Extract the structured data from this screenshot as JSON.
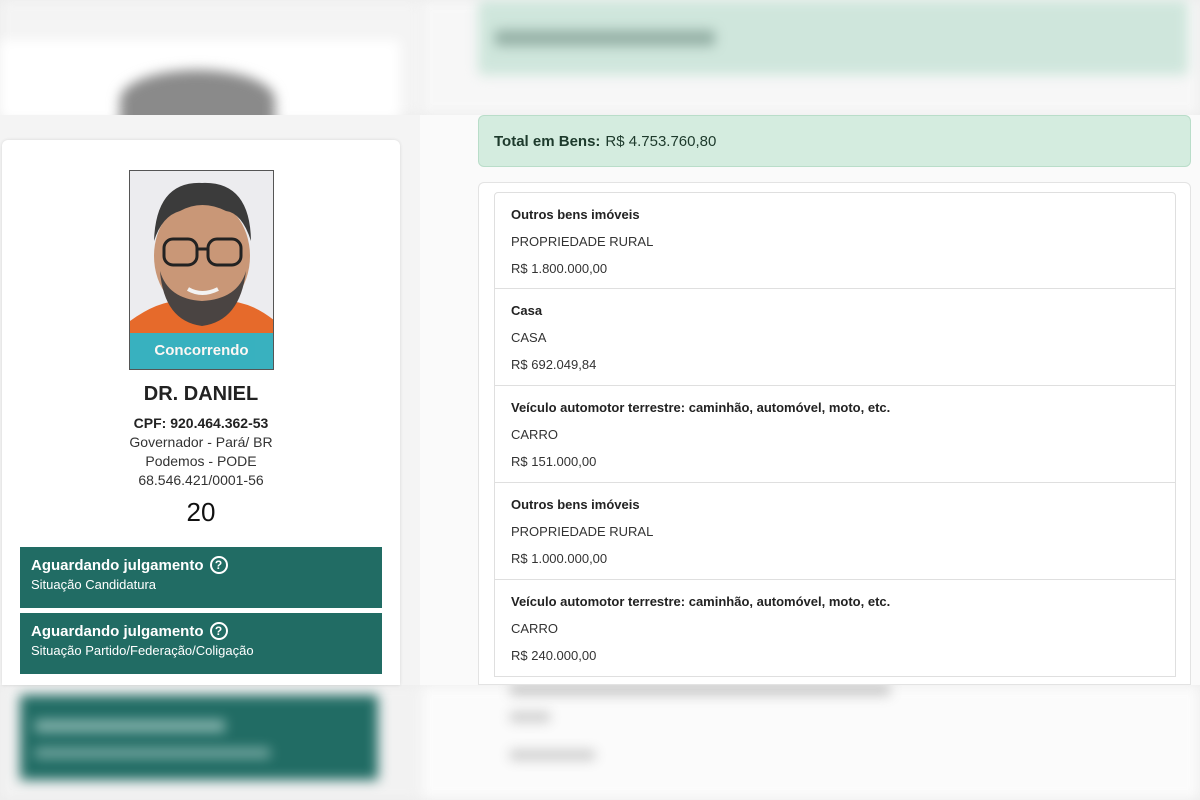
{
  "candidate": {
    "photo_badge": "Concorrendo",
    "name": "DR. DANIEL",
    "cpf": "CPF: 920.464.362-53",
    "office": "Governador - Pará/ BR",
    "party": "Podemos - PODE",
    "cnpj": "68.546.421/0001-56",
    "number": "20"
  },
  "status": [
    {
      "title": "Aguardando julgamento",
      "subtitle": "Situação Candidatura"
    },
    {
      "title": "Aguardando julgamento",
      "subtitle": "Situação Partido/Federação/Coligação"
    }
  ],
  "total": {
    "label": "Total em Bens:",
    "value": "R$ 4.753.760,80"
  },
  "assets": [
    {
      "type": "Outros bens imóveis",
      "description": "PROPRIEDADE RURAL",
      "value": "R$ 1.800.000,00"
    },
    {
      "type": "Casa",
      "description": "CASA",
      "value": "R$ 692.049,84"
    },
    {
      "type": "Veículo automotor terrestre: caminhão, automóvel, moto, etc.",
      "description": "CARRO",
      "value": "R$ 151.000,00"
    },
    {
      "type": "Outros bens imóveis",
      "description": "PROPRIEDADE RURAL",
      "value": "R$ 1.000.000,00"
    },
    {
      "type": "Veículo automotor terrestre: caminhão, automóvel, moto, etc.",
      "description": "CARRO",
      "value": "R$ 240.000,00"
    }
  ],
  "colors": {
    "status_bg": "#216c64",
    "badge_bg": "#2fb5c7",
    "total_bg": "#d4ecdf"
  }
}
